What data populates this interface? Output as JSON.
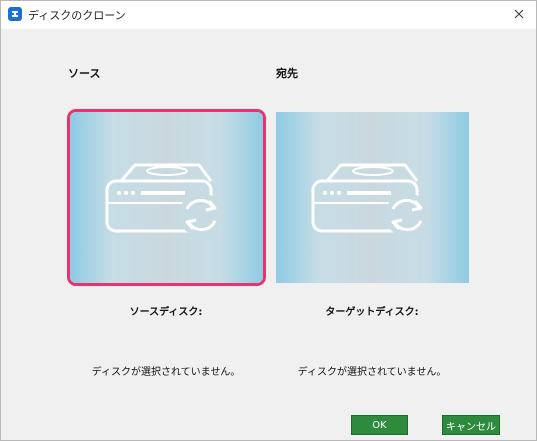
{
  "window": {
    "title": "ディスクのクローン"
  },
  "source": {
    "header": "ソース",
    "disk_label": "ソースディスク:",
    "status": "ディスクが選択されていません。"
  },
  "destination": {
    "header": "宛先",
    "disk_label": "ターゲットディスク:",
    "status": "ディスクが選択されていません。"
  },
  "buttons": {
    "ok": "OK",
    "cancel": "キャンセル"
  },
  "colors": {
    "selection": "#e8336f",
    "button": "#2e8b3e",
    "panel_edge": "#8ecbe3"
  },
  "icons": {
    "app": "app-logo-icon",
    "close": "close-icon",
    "disk": "disk-clone-icon"
  }
}
